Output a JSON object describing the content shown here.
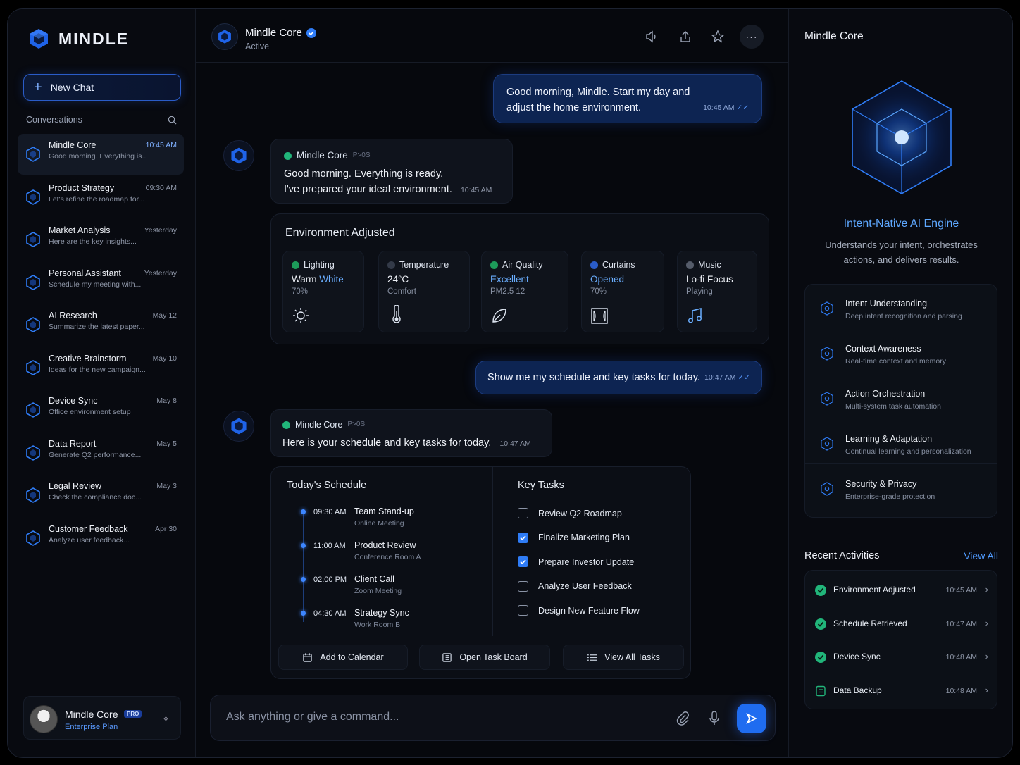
{
  "brand": {
    "name": "MINDLE"
  },
  "sidebar": {
    "new_chat_label": "New Chat",
    "conversations_label": "Conversations",
    "items": [
      {
        "title": "Mindle Core",
        "preview": "Good morning. Everything is...",
        "time": "10:45 AM"
      },
      {
        "title": "Product Strategy",
        "preview": "Let's refine the roadmap for...",
        "time": "09:30 AM"
      },
      {
        "title": "Market Analysis",
        "preview": "Here are the key insights...",
        "time": "Yesterday"
      },
      {
        "title": "Personal Assistant",
        "preview": "Schedule my meeting with...",
        "time": "Yesterday"
      },
      {
        "title": "AI Research",
        "preview": "Summarize the latest paper...",
        "time": "May 12"
      },
      {
        "title": "Creative Brainstorm",
        "preview": "Ideas for the new campaign...",
        "time": "May 10"
      },
      {
        "title": "Device Sync",
        "preview": "Office environment setup",
        "time": "May 8"
      },
      {
        "title": "Data Report",
        "preview": "Generate Q2 performance...",
        "time": "May 5"
      },
      {
        "title": "Legal Review",
        "preview": "Check the compliance doc...",
        "time": "May 3"
      },
      {
        "title": "Customer Feedback",
        "preview": "Analyze user feedback...",
        "time": "Apr 30"
      }
    ],
    "user": {
      "name": "Mindle Core",
      "badge": "PRO",
      "plan": "Enterprise Plan"
    }
  },
  "chat": {
    "header": {
      "name": "Mindle Core",
      "status": "Active"
    },
    "msg1": {
      "text1": "Good morning, Mindle. Start my day and",
      "text2": "adjust the home environment.",
      "time": "10:45 AM"
    },
    "reply1": {
      "name": "Mindle Core",
      "os": "P>0S",
      "line1": "Good morning. Everything is ready.",
      "line2": "I've prepared your ideal environment.",
      "time": "10:45 AM"
    },
    "env": {
      "title": "Environment Adjusted",
      "items": [
        {
          "label": "Lighting",
          "val_a": "Warm",
          "val_b": "White",
          "sub": "70%"
        },
        {
          "label": "Temperature",
          "val": "24°C",
          "sub": "Comfort"
        },
        {
          "label": "Air Quality",
          "val": "Excellent",
          "sub": "PM2.5 12"
        },
        {
          "label": "Curtains",
          "val": "Opened",
          "sub": "70%"
        },
        {
          "label": "Music",
          "val": "Lo-fi Focus",
          "sub": "Playing"
        }
      ]
    },
    "msg2": {
      "text": "Show me my schedule and key tasks for today.",
      "time": "10:47 AM"
    },
    "reply2": {
      "name": "Mindle Core",
      "os": "P>0S",
      "text": "Here is your schedule and key tasks for today.",
      "time": "10:47 AM"
    },
    "schedule": {
      "title": "Today's Schedule",
      "items": [
        {
          "time": "09:30 AM",
          "title": "Team Stand-up",
          "loc": "Online Meeting"
        },
        {
          "time": "11:00 AM",
          "title": "Product Review",
          "loc": "Conference Room A"
        },
        {
          "time": "02:00 PM",
          "title": "Client Call",
          "loc": "Zoom Meeting"
        },
        {
          "time": "04:30 AM",
          "title": "Strategy Sync",
          "loc": "Work Room B"
        }
      ]
    },
    "tasks": {
      "title": "Key Tasks",
      "items": [
        {
          "label": "Review Q2 Roadmap",
          "done": false
        },
        {
          "label": "Finalize Marketing Plan",
          "done": true
        },
        {
          "label": "Prepare Investor Update",
          "done": true
        },
        {
          "label": "Analyze User Feedback",
          "done": false
        },
        {
          "label": "Design New Feature Flow",
          "done": false
        }
      ]
    },
    "actions": {
      "calendar": "Add to Calendar",
      "board": "Open Task Board",
      "all": "View All Tasks"
    },
    "input": {
      "placeholder": "Ask anything or give a command..."
    }
  },
  "panel": {
    "title": "Mindle Core",
    "engine_title": "Intent-Native AI Engine",
    "engine_desc1": "Understands your intent, orchestrates",
    "engine_desc2": "actions, and delivers results.",
    "features": [
      {
        "title": "Intent Understanding",
        "desc": "Deep intent recognition and parsing"
      },
      {
        "title": "Context Awareness",
        "desc": "Real-time context and memory"
      },
      {
        "title": "Action Orchestration",
        "desc": "Multi-system task automation"
      },
      {
        "title": "Learning & Adaptation",
        "desc": "Continual learning and personalization"
      },
      {
        "title": "Security & Privacy",
        "desc": "Enterprise-grade protection"
      }
    ],
    "recent_title": "Recent Activities",
    "view_all": "View All",
    "recent": [
      {
        "title": "Environment Adjusted",
        "time": "10:45 AM"
      },
      {
        "title": "Schedule Retrieved",
        "time": "10:47 AM"
      },
      {
        "title": "Device Sync",
        "time": "10:48 AM"
      },
      {
        "title": "Data Backup",
        "time": "10:48 AM"
      }
    ]
  },
  "colors": {
    "accent": "#2f7cf6",
    "bg": "#07090e",
    "user_bubble": "#0d2452"
  }
}
